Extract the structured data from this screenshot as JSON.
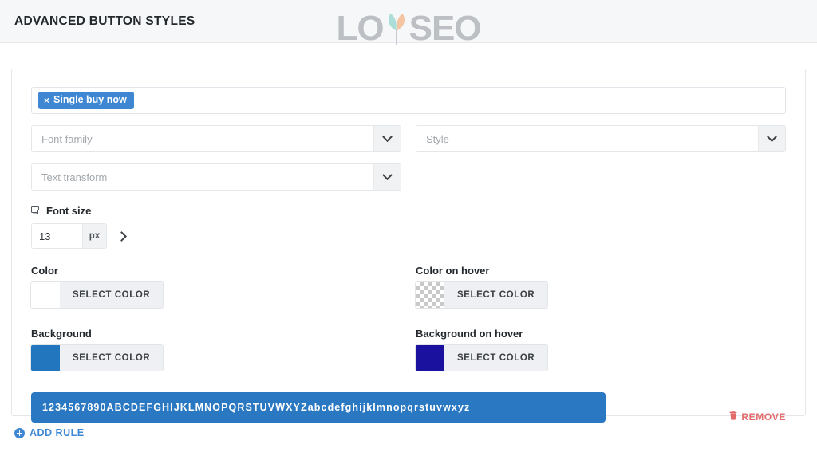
{
  "header": {
    "title": "ADVANCED BUTTON STYLES",
    "logo": {
      "text_before": "LO",
      "text_after": "SEO",
      "glyph_name": "y-leaf-glyph",
      "leaf_left_color": "#7fd0c4",
      "leaf_right_color": "#f2a870",
      "text_color": "#9aa0a6"
    }
  },
  "rule": {
    "tags_field": {
      "tags": [
        {
          "label": "Single buy now",
          "close_icon": "close-icon",
          "color": "#3f87d3"
        }
      ]
    },
    "selects": [
      {
        "name": "font-family",
        "placeholder": "Font family",
        "value": "",
        "arrow_icon": "chevron-down-icon"
      },
      {
        "name": "style",
        "placeholder": "Style",
        "value": "",
        "arrow_icon": "chevron-down-icon"
      },
      {
        "name": "text-transform",
        "placeholder": "Text transform",
        "value": "",
        "arrow_icon": "chevron-down-icon"
      }
    ],
    "font_size": {
      "device_icon": "desktop-icon",
      "label": "Font size",
      "value": "13",
      "unit": "px",
      "next_icon": "chevron-right-icon"
    },
    "colors": [
      {
        "name": "color",
        "label": "Color",
        "swatch": "#ffffff",
        "transparent": false,
        "button_label": "SELECT COLOR"
      },
      {
        "name": "color-on-hover",
        "label": "Color on hover",
        "swatch": "transparent",
        "transparent": true,
        "button_label": "SELECT COLOR"
      },
      {
        "name": "background",
        "label": "Background",
        "swatch": "#2176bd",
        "transparent": false,
        "button_label": "SELECT COLOR"
      },
      {
        "name": "background-on-hover",
        "label": "Background on hover",
        "swatch": "#1a129e",
        "transparent": false,
        "button_label": "SELECT COLOR"
      }
    ],
    "preview": {
      "text": "1234567890ABCDEFGHIJKLMNOPQRSTUVWXYZabcdefghijklmnopqrstuvwxyz",
      "background": "#2b78c2",
      "text_color": "#ffffff"
    },
    "remove": {
      "label": "REMOVE",
      "icon": "trash-icon",
      "color": "#e26a6a"
    }
  },
  "footer": {
    "add_rule": {
      "label": "ADD RULE",
      "icon": "plus-circle-icon",
      "color": "#3f87d3"
    }
  }
}
